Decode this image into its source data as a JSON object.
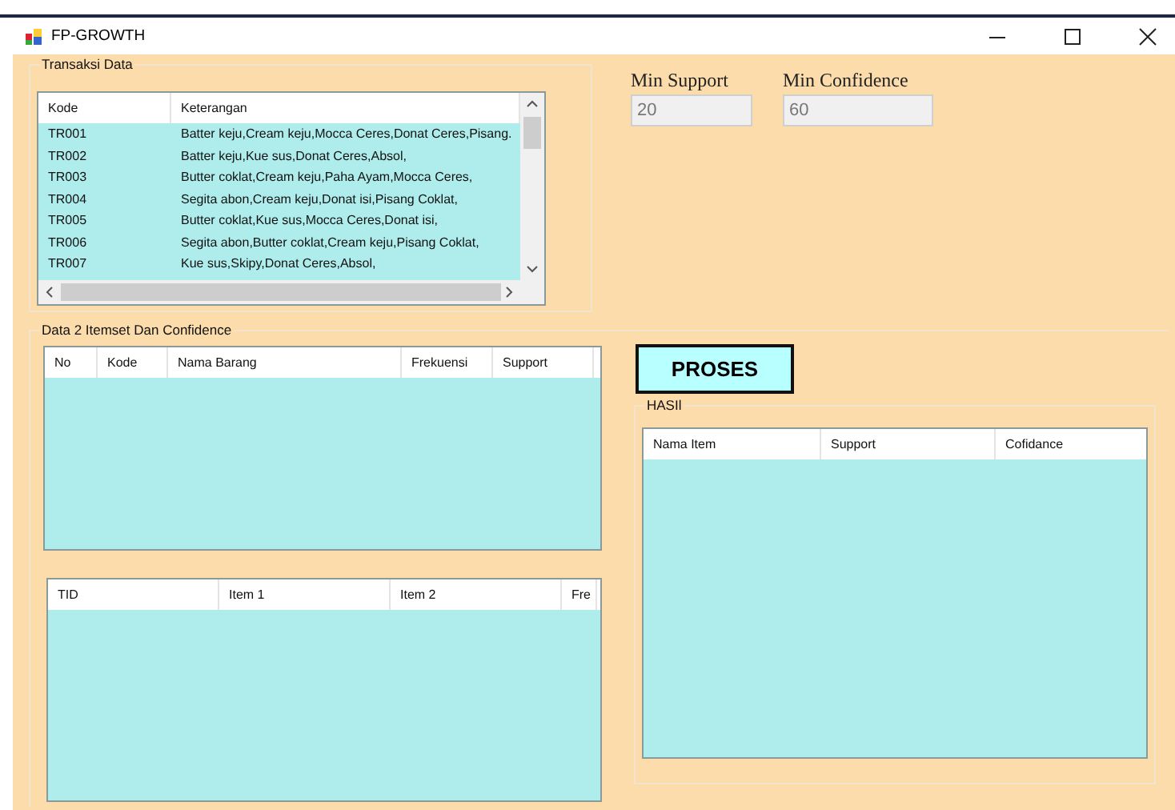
{
  "window": {
    "title": "FP-GROWTH"
  },
  "transaksi": {
    "title": "Transaksi Data",
    "columns": [
      "Kode",
      "Keterangan"
    ],
    "rows": [
      [
        "TR001",
        "Batter keju,Cream keju,Mocca Ceres,Donat Ceres,Pisang."
      ],
      [
        "TR002",
        "Batter keju,Kue sus,Donat Ceres,Absol,"
      ],
      [
        "TR003",
        "Butter coklat,Cream keju,Paha Ayam,Mocca Ceres,"
      ],
      [
        "TR004",
        "Segita abon,Cream keju,Donat isi,Pisang Coklat,"
      ],
      [
        "TR005",
        "Butter coklat,Kue sus,Mocca Ceres,Donat isi,"
      ],
      [
        "TR006",
        "Segita abon,Butter coklat,Cream keju,Pisang Coklat,"
      ],
      [
        "TR007",
        "Kue sus,Skipy,Donat Ceres,Absol,"
      ]
    ]
  },
  "min_support": {
    "label": "Min Support",
    "value": "20",
    "disabled": true
  },
  "min_confidence": {
    "label": "Min Confidence",
    "value": "60",
    "disabled": true
  },
  "itemset": {
    "title": "Data 2 Itemset Dan Confidence",
    "table_1": {
      "columns": [
        "No",
        "Kode",
        "Nama Barang",
        "Frekuensi",
        "Support"
      ]
    },
    "table_2": {
      "columns": [
        "TID",
        "Item 1",
        "Item 2",
        "Fre"
      ]
    }
  },
  "proses_button": {
    "label": "PROSES"
  },
  "hasil": {
    "title": "HASIl",
    "columns": [
      "Nama Item",
      "Support",
      "Cofidance"
    ]
  }
}
